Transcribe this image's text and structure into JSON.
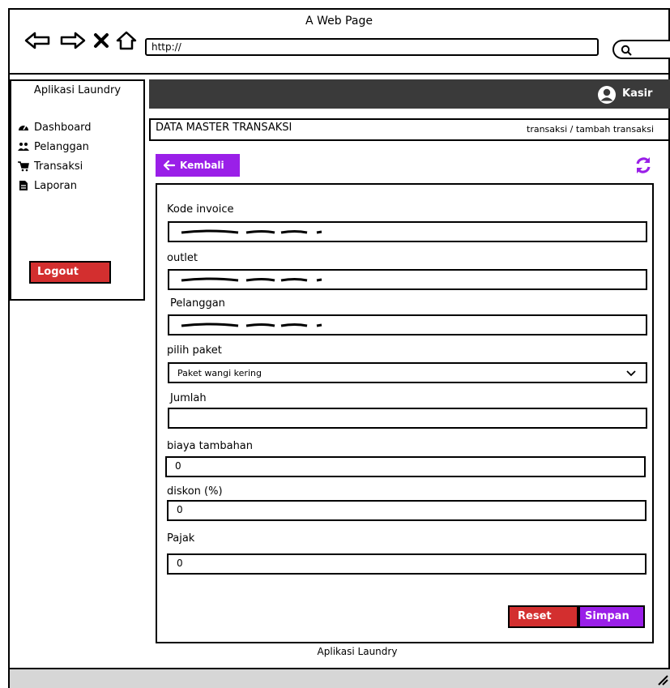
{
  "window": {
    "title": "A Web Page"
  },
  "browser": {
    "url": "http://"
  },
  "sidebar": {
    "title": "Aplikasi Laundry",
    "items": [
      {
        "label": "Dashboard",
        "icon": "dashboard-icon"
      },
      {
        "label": "Pelanggan",
        "icon": "users-icon"
      },
      {
        "label": "Transaksi",
        "icon": "cart-icon"
      },
      {
        "label": "Laporan",
        "icon": "file-icon"
      }
    ],
    "logout_label": "Logout"
  },
  "topbar": {
    "user_label": "Kasir"
  },
  "header": {
    "title": "DATA MASTER TRANSAKSI",
    "breadcrumb": "transaksi / tambah transaksi"
  },
  "toolbar": {
    "back_label": "Kembali"
  },
  "form": {
    "kode_invoice_label": "Kode invoice",
    "outlet_label": "outlet",
    "pelanggan_label": "Pelanggan",
    "paket_label": "pilih paket",
    "paket_value": "Paket wangi kering",
    "jumlah_label": "Jumlah",
    "jumlah_value": "",
    "biaya_label": "biaya tambahan",
    "biaya_value": "0",
    "diskon_label": "diskon (%)",
    "diskon_value": "0",
    "pajak_label": "Pajak",
    "pajak_value": "0",
    "reset_label": "Reset",
    "simpan_label": "Simpan"
  },
  "footer": {
    "text": "Aplikasi Laundry"
  },
  "colors": {
    "purple": "#9a1fe8",
    "red": "#d32f2f",
    "topbar": "#3a3a3a"
  }
}
